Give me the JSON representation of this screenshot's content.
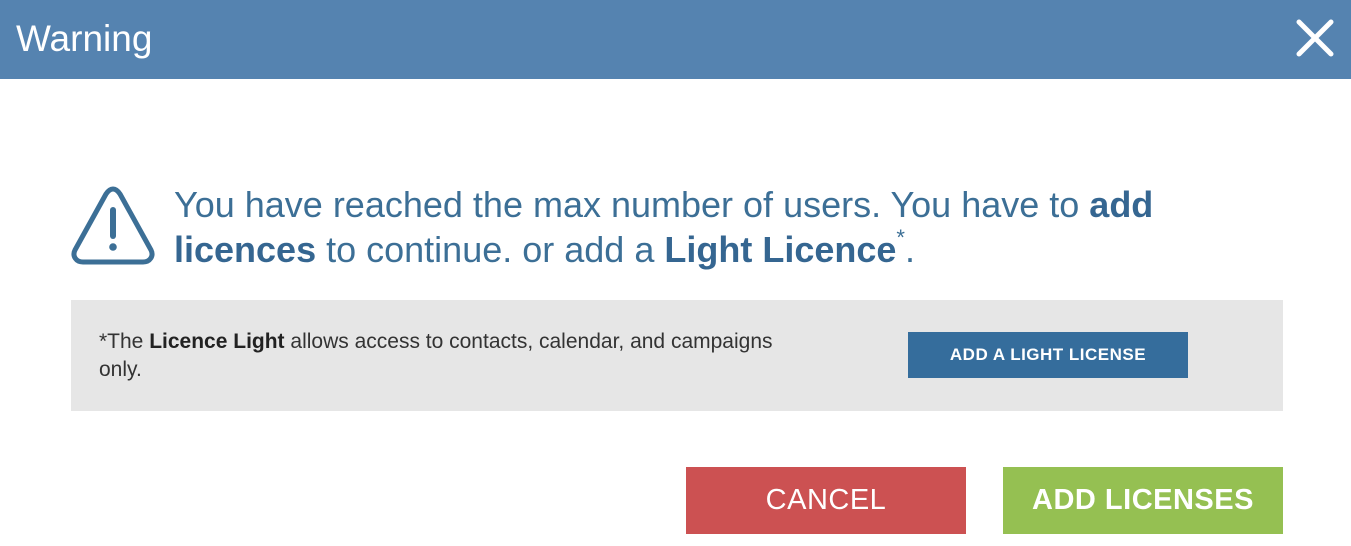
{
  "dialog": {
    "title": "Warning",
    "close_icon": "close-icon",
    "warning_icon": "warning-triangle-icon"
  },
  "message": {
    "part1": "You have reached the max number of users. You have to ",
    "bold1": "add licences",
    "part2": " to continue. or add a ",
    "bold2": "Light Licence",
    "sup": "*",
    "part3": "."
  },
  "info": {
    "prefix": "*The ",
    "bold": "Licence Light",
    "suffix": " allows access to contacts, calendar, and campaigns only.",
    "button_label": "ADD A LIGHT LICENSE"
  },
  "footer": {
    "cancel_label": "CANCEL",
    "add_label": "ADD LICENSES"
  },
  "colors": {
    "header_bg": "#5583b0",
    "text_blue": "#3c6f96",
    "cancel_red": "#cc5152",
    "add_green": "#95c052",
    "light_btn_blue": "#356d9c",
    "info_bg": "#e6e6e6"
  }
}
